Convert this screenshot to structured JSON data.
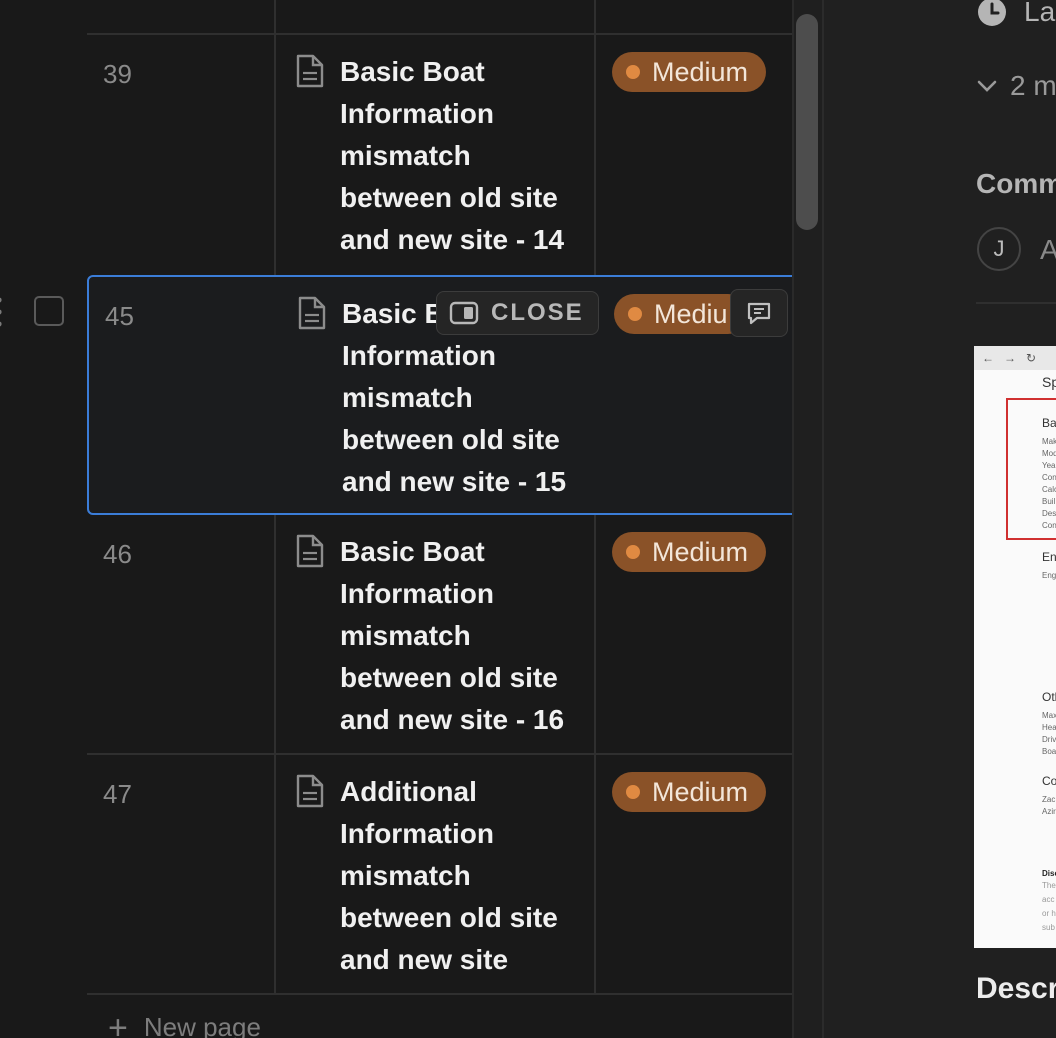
{
  "table": {
    "rows": [
      {
        "num": "39",
        "title": "Basic Boat Information mismatch between old site and new site - 14",
        "priority": "Medium"
      },
      {
        "num": "45",
        "title": "Basic Boat Information mismatch between old site and new site - 15",
        "priority": "Medium"
      },
      {
        "num": "46",
        "title": "Basic Boat Information mismatch between old site and new site - 16",
        "priority": "Medium"
      },
      {
        "num": "47",
        "title": "Additional Information mismatch between old site and new site",
        "priority": "Medium"
      }
    ],
    "selected_title_visible": "Basic B",
    "selected_title_rest": "Information mismatch between old site and new site - 15",
    "selected_priority_visible": "Mediu",
    "close_label": "CLOSE",
    "new_page_label": "New page",
    "priority_color": "#8a5228"
  },
  "detail": {
    "last_edited_partial": "La",
    "more_props_partial": "2 m",
    "comments_partial": "Comm",
    "avatar_initial": "J",
    "comment_input_partial": "A",
    "description_partial": "Descr",
    "screenshot": {
      "section1": "Bas",
      "section1_lines": [
        "Mak",
        "Mod",
        "Yea",
        "Con",
        "Calc",
        "Buil",
        "Des",
        "Con"
      ],
      "header": "Sp",
      "section2": "Eng",
      "section2_lines": [
        "Eng"
      ],
      "section3": "Oth",
      "section3_lines": [
        "Max",
        "Hea",
        "Driv",
        "Boa"
      ],
      "section4": "Co",
      "section4_lines": [
        "Zac",
        "Azir"
      ],
      "section5": "Disc",
      "section5_lines": [
        "The",
        "acc",
        "or h",
        "sub"
      ]
    }
  },
  "icons": {
    "doc": "document-icon",
    "close": "sidebar-panel-icon",
    "comment": "comment-icon",
    "clock": "clock-icon",
    "chevron": "chevron-down-icon",
    "plus": "plus-icon",
    "drag": "drag-handle-icon"
  }
}
